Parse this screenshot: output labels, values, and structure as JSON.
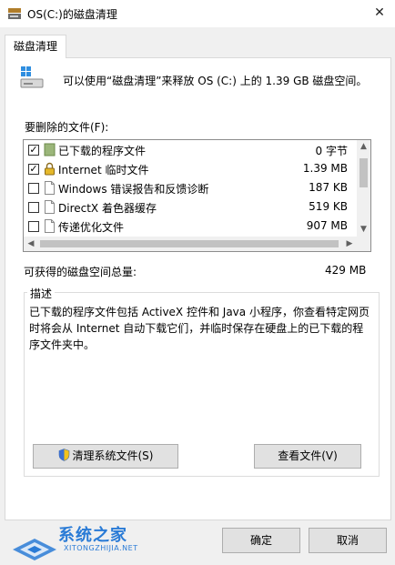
{
  "window": {
    "title": "OS(C:)的磁盘清理",
    "close_glyph": "✕"
  },
  "tab": {
    "label": "磁盘清理"
  },
  "intro_text": "可以使用“磁盘清理”来释放 OS (C:) 上的 1.39 GB 磁盘空间。",
  "files_label": "要删除的文件(F):",
  "files": [
    {
      "name": "已下载的程序文件",
      "size": "0 字节",
      "checked": true,
      "icon": "downloaded-program-icon"
    },
    {
      "name": "Internet 临时文件",
      "size": "1.39 MB",
      "checked": true,
      "icon": "lock-icon"
    },
    {
      "name": "Windows 错误报告和反馈诊断",
      "size": "187 KB",
      "checked": false,
      "icon": "file-icon"
    },
    {
      "name": "DirectX 着色器缓存",
      "size": "519 KB",
      "checked": false,
      "icon": "file-icon"
    },
    {
      "name": "传递优化文件",
      "size": "907 MB",
      "checked": false,
      "icon": "file-icon"
    }
  ],
  "total": {
    "label": "可获得的磁盘空间总量:",
    "value": "429 MB"
  },
  "description": {
    "legend": "描述",
    "text": "已下载的程序文件包括 ActiveX 控件和 Java 小程序，你查看特定网页时将会从 Internet 自动下载它们，并临时保存在硬盘上的已下载的程序文件夹中。"
  },
  "buttons": {
    "clean_system": "清理系统文件(S)",
    "view_files": "查看文件(V)",
    "ok": "确定",
    "cancel": "取消"
  },
  "watermark": {
    "name": "系统之家",
    "url": "XITONGZHIJIA.NET"
  },
  "colors": {
    "accent": "#2a7bd6",
    "button_bg": "#e1e1e1",
    "background": "#f0f0f0"
  }
}
